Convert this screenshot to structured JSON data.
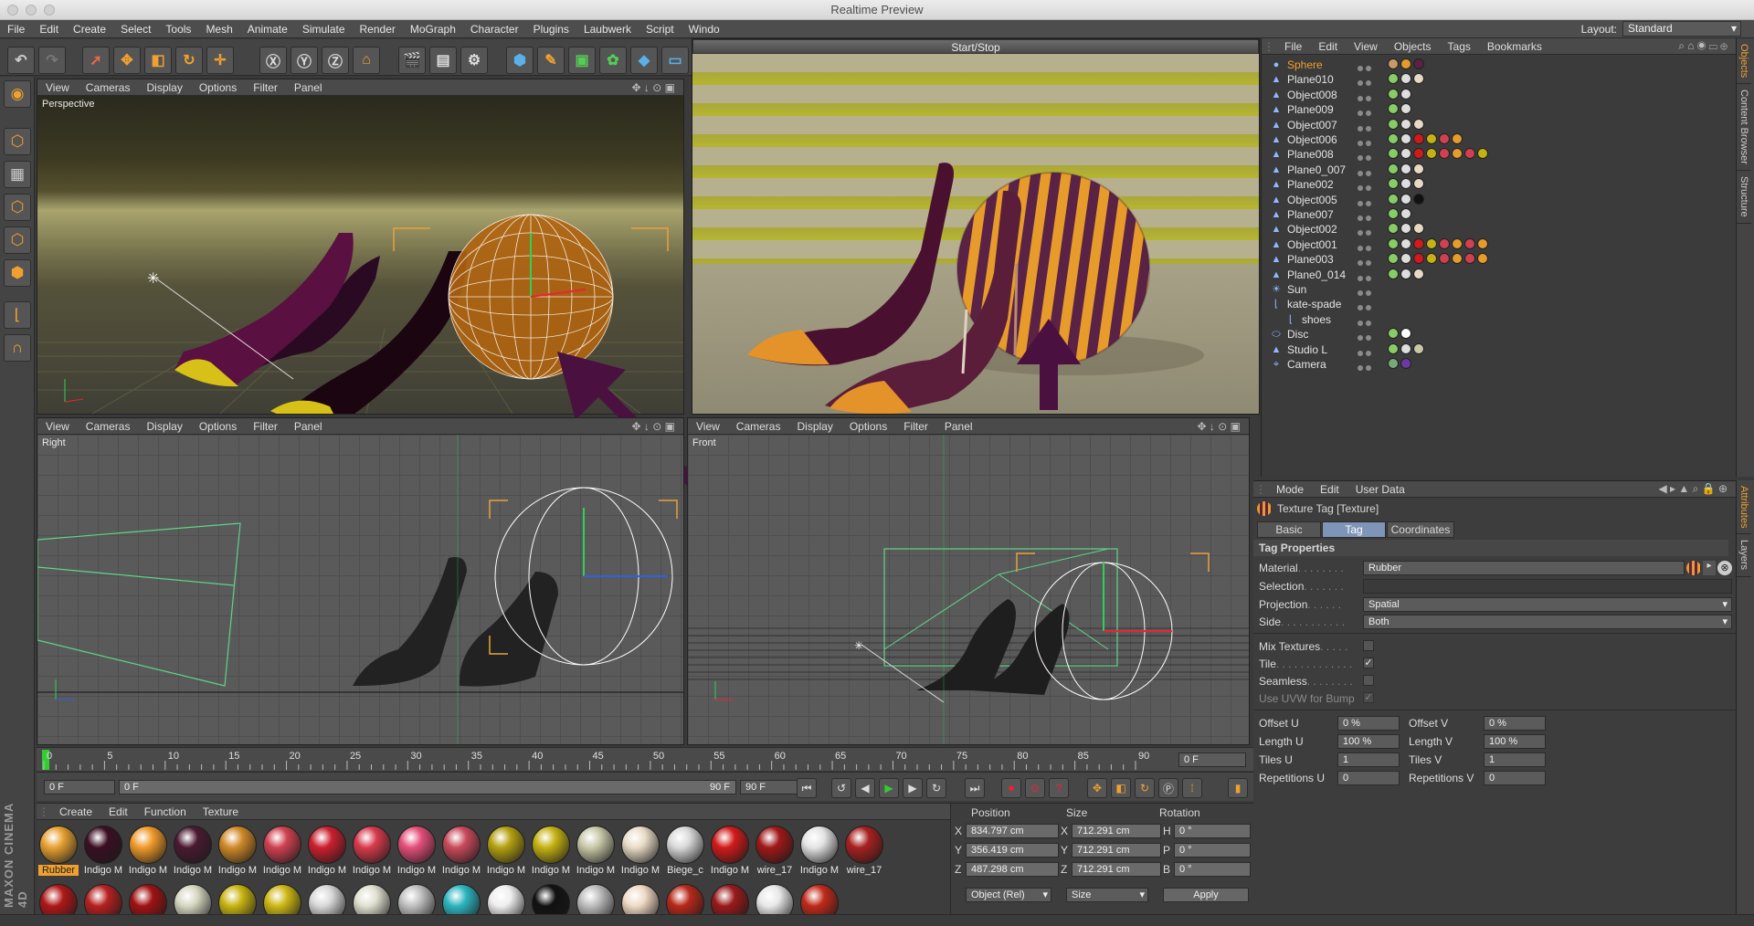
{
  "window": {
    "title": "Realtime Preview"
  },
  "menu": [
    "File",
    "Edit",
    "Create",
    "Select",
    "Tools",
    "Mesh",
    "Animate",
    "Simulate",
    "Render",
    "MoGraph",
    "Character",
    "Plugins",
    "Laubwerk",
    "Script",
    "Windo"
  ],
  "layout": {
    "label": "Layout:",
    "value": "Standard"
  },
  "viewport_menu": [
    "View",
    "Cameras",
    "Display",
    "Options",
    "Filter",
    "Panel"
  ],
  "viewports": {
    "perspective": "Perspective",
    "right": "Right",
    "front": "Front"
  },
  "preview": {
    "button": "Start/Stop"
  },
  "object_manager": {
    "menu": [
      "File",
      "Edit",
      "View",
      "Objects",
      "Tags",
      "Bookmarks"
    ],
    "objects": [
      {
        "name": "Sphere",
        "selected": true
      },
      {
        "name": "Plane010"
      },
      {
        "name": "Object008"
      },
      {
        "name": "Plane009"
      },
      {
        "name": "Object007"
      },
      {
        "name": "Object006"
      },
      {
        "name": "Plane008"
      },
      {
        "name": "Plane0_007"
      },
      {
        "name": "Plane002"
      },
      {
        "name": "Object005"
      },
      {
        "name": "Plane007"
      },
      {
        "name": "Object002"
      },
      {
        "name": "Object001"
      },
      {
        "name": "Plane003"
      },
      {
        "name": "Plane0_014"
      },
      {
        "name": "Sun"
      },
      {
        "name": "kate-spade"
      },
      {
        "name": "shoes"
      },
      {
        "name": "Disc"
      },
      {
        "name": "Studio L"
      },
      {
        "name": "Camera"
      }
    ],
    "side_tabs": [
      "Objects",
      "Content Browser",
      "Structure"
    ]
  },
  "attributes": {
    "menu": [
      "Mode",
      "Edit",
      "User Data"
    ],
    "title": "Texture Tag [Texture]",
    "tabs": [
      "Basic",
      "Tag",
      "Coordinates"
    ],
    "section": "Tag Properties",
    "material_label": "Material",
    "material": "Rubber",
    "selection_label": "Selection",
    "projection_label": "Projection",
    "projection": "Spatial",
    "side_label": "Side",
    "side": "Both",
    "mix_textures": "Mix Textures",
    "tile": "Tile",
    "seamless": "Seamless",
    "use_uvw": "Use UVW for Bump",
    "offset_u_label": "Offset U",
    "offset_u": "0 %",
    "offset_v_label": "Offset V",
    "offset_v": "0 %",
    "length_u_label": "Length U",
    "length_u": "100 %",
    "length_v_label": "Length V",
    "length_v": "100 %",
    "tiles_u_label": "Tiles U",
    "tiles_u": "1",
    "tiles_v_label": "Tiles V",
    "tiles_v": "1",
    "rep_u_label": "Repetitions U",
    "rep_u": "0",
    "rep_v_label": "Repetitions V",
    "rep_v": "0",
    "side_tabs": [
      "Attributes",
      "Layers"
    ]
  },
  "timeline": {
    "ticks": [
      "0",
      "5",
      "10",
      "15",
      "20",
      "25",
      "30",
      "35",
      "40",
      "45",
      "50",
      "55",
      "60",
      "65",
      "70",
      "75",
      "80",
      "85",
      "90"
    ],
    "frame_end": "0 F",
    "start": "0 F",
    "current": "0 F",
    "range_end": "90 F",
    "end": "90 F"
  },
  "material_manager": {
    "menu": [
      "Create",
      "Edit",
      "Function",
      "Texture"
    ],
    "row1": [
      {
        "label": "Rubber",
        "color": "#e7a132"
      },
      {
        "label": "Indigo M",
        "color": "#3a0f22"
      },
      {
        "label": "Indigo M",
        "color": "#f09a2a"
      },
      {
        "label": "Indigo M",
        "color": "#4a1a30"
      },
      {
        "label": "Indigo M",
        "color": "#d08a28"
      },
      {
        "label": "Indigo M",
        "color": "#d04050"
      },
      {
        "label": "Indigo M",
        "color": "#cc1f2f"
      },
      {
        "label": "Indigo M",
        "color": "#d83a4c"
      },
      {
        "label": "Indigo M",
        "color": "#e44e7a"
      },
      {
        "label": "Indigo M",
        "color": "#c94a5a"
      },
      {
        "label": "Indigo M",
        "color": "#b4a010"
      },
      {
        "label": "Indigo M",
        "color": "#c5b212"
      },
      {
        "label": "Indigo M",
        "color": "#c8c8a8"
      },
      {
        "label": "Indigo M",
        "color": "#e9dcc6"
      },
      {
        "label": "Biege_c",
        "color": "#d9d9d9"
      },
      {
        "label": "Indigo M",
        "color": "#d21a1a"
      },
      {
        "label": "wire_17",
        "color": "#a01818"
      },
      {
        "label": "Indigo M",
        "color": "#e4e4e4"
      },
      {
        "label": "wire_17",
        "color": "#a82020"
      }
    ],
    "row2": [
      "#b01818",
      "#b62020",
      "#a01212",
      "#d6d6c0",
      "#c8b410",
      "#cdb814",
      "#d8d8d8",
      "#e0e0d0",
      "#bfbfbf",
      "#2db5c0",
      "#eeeeee",
      "#111111",
      "#bcbcbc",
      "#efd9c4",
      "#b8281a",
      "#9a1a1a",
      "#e8e8e8",
      "#c02a1a"
    ]
  },
  "coordinates": {
    "position_label": "Position",
    "size_label": "Size",
    "rotation_label": "Rotation",
    "x_pos": "834.797 cm",
    "y_pos": "356.419 cm",
    "z_pos": "487.298 cm",
    "x_size": "712.291 cm",
    "y_size": "712.291 cm",
    "z_size": "712.291 cm",
    "h": "0 °",
    "p": "0 °",
    "b": "0 °",
    "mode": "Object (Rel)",
    "size_mode": "Size",
    "apply": "Apply"
  },
  "brand": "MAXON CINEMA 4D"
}
